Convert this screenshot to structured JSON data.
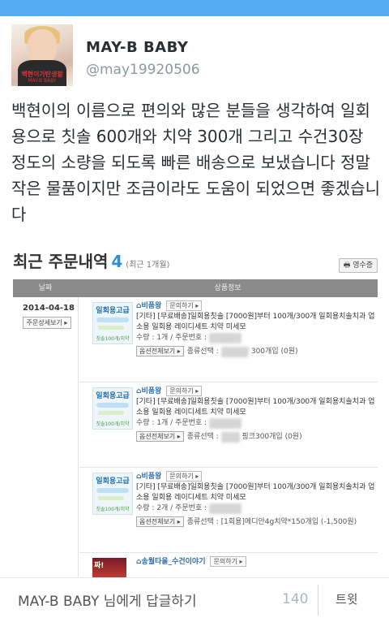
{
  "tweet": {
    "display_name": "MAY-B BABY",
    "handle": "@may19920506",
    "avatar_text_1": "백현이가탄생할",
    "avatar_text_2": "MAY-B BABY",
    "text": "백현이의 이름으로 편의와 많은 분들을 생각하여 일회용으로 칫솔 600개와 치약 300개 그리고 수건30장 정도의 소량을 되도록 빠른 배송으로 보냈습니다 정말 작은 물품이지만 조금이라도 도움이 되었으면 좋겠습니다"
  },
  "order_page": {
    "title": "최근 주문내역",
    "count": "4",
    "sub_count": "(최근 1개월)",
    "receipt_button": "영수증",
    "col_date": "날짜",
    "col_product": "상품정보",
    "order_date": "2014-04-18",
    "order_detail_button": "주문상세보기",
    "thumb_title": "일회용고급",
    "thumb_bottom": "칫솔100개/치약",
    "items": [
      {
        "seller": "비품왕",
        "inquiry": "문의하기",
        "title": "[기타] [무료배송]일회용칫솔 [7000원]부터 100개/300개 일회용치솔치과 업소용 일회용 레이디세트 치약 미세모",
        "qty": "수량 : 1개 / 주문번호 :",
        "option_button": "옵션전체보기",
        "option_label": "종류선택 :",
        "option_value": "300개입 (0원)"
      },
      {
        "seller": "비품왕",
        "inquiry": "문의하기",
        "title": "[기타] [무료배송]일회용칫솔 [7000원]부터 100개/300개 일회용치솔치과 업소용 일회용 레이디세트 치약 미세모",
        "qty": "수량 : 1개 / 주문번호 :",
        "option_button": "옵션전체보기",
        "option_label": "종류선택 :",
        "option_value": "핑크300개입 (0원)"
      },
      {
        "seller": "비품왕",
        "inquiry": "문의하기",
        "title": "[기타] [무료배송]일회용칫솔 [7000원]부터 100개/300개 일회용치솔치과 업소용 일회용 레이디세트 치약 미세모",
        "qty": "수량 : 2개 / 주문번호 :",
        "option_button": "옵션전체보기",
        "option_label": "종류선택 :",
        "option_value": "[1회용]메디안4g치약*150개입 (-1,500원)"
      },
      {
        "seller": "송월타올_수건이야기",
        "inquiry": "문의하기",
        "thumb_text": "짜!"
      }
    ]
  },
  "reply": {
    "placeholder": "MAY-B BABY 님에게 답글하기",
    "char_count": "140",
    "tweet_button": "트윗"
  },
  "colors": {
    "twitter_blue": "#55acee",
    "count_blue": "#2a8fd6",
    "muted": "#8899a6"
  }
}
